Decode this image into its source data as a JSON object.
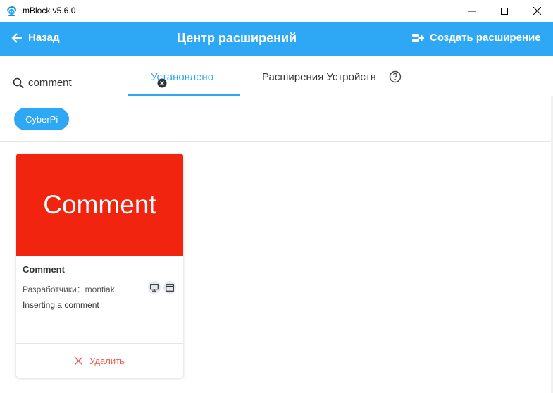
{
  "window": {
    "title": "mBlock v5.6.0"
  },
  "header": {
    "back_label": "Назад",
    "title": "Центр расширений",
    "create_label": "Создать расширение"
  },
  "search": {
    "value": "comment",
    "placeholder": ""
  },
  "tabs": [
    {
      "label": "Установлено",
      "active": true
    },
    {
      "label": "Расширения Устройств",
      "active": false
    }
  ],
  "chips": [
    {
      "label": "CyberPi",
      "selected": true
    }
  ],
  "cards": [
    {
      "banner_text": "Comment",
      "banner_color": "#f1240f",
      "title": "Comment",
      "developer": "Разработчики：montiak",
      "description": "Inserting a comment",
      "platforms": [
        "monitor-icon",
        "browser-window-icon"
      ],
      "action_label": "Удалить"
    }
  ],
  "colors": {
    "accent": "#2ea8f5",
    "danger": "#f25c54"
  },
  "icons": {
    "app": "mblock-logo-icon",
    "back": "arrow-left-icon",
    "create": "create-extension-icon",
    "search": "search-icon",
    "clear": "clear-icon",
    "help": "question-icon",
    "remove": "close-icon"
  }
}
